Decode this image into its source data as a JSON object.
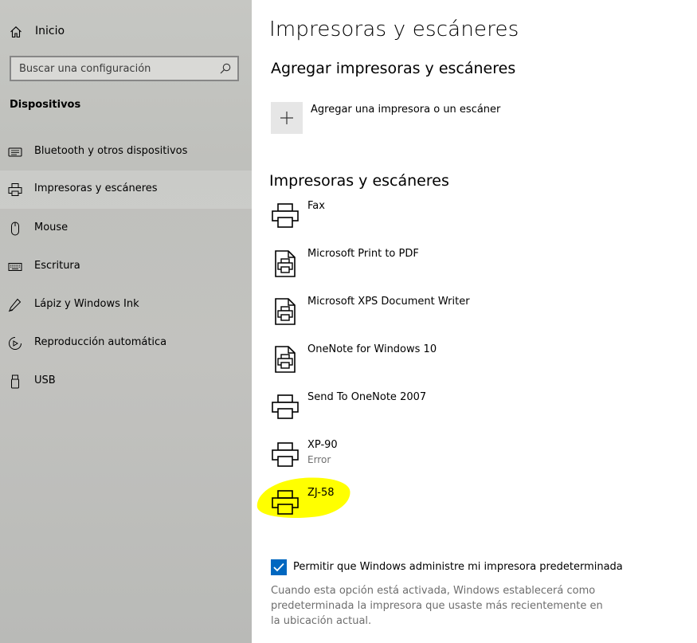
{
  "sidebar": {
    "home_label": "Inicio",
    "search": {
      "placeholder": "Buscar una configuración",
      "value": ""
    },
    "section_title": "Dispositivos",
    "items": [
      {
        "label": "Bluetooth y otros dispositivos",
        "icon": "bluetooth-devices-icon",
        "selected": false
      },
      {
        "label": "Impresoras y escáneres",
        "icon": "printer-icon",
        "selected": true
      },
      {
        "label": "Mouse",
        "icon": "mouse-icon",
        "selected": false
      },
      {
        "label": "Escritura",
        "icon": "keyboard-icon",
        "selected": false
      },
      {
        "label": "Lápiz y Windows Ink",
        "icon": "pen-icon",
        "selected": false
      },
      {
        "label": "Reproducción automática",
        "icon": "autoplay-icon",
        "selected": false
      },
      {
        "label": "USB",
        "icon": "usb-icon",
        "selected": false
      }
    ]
  },
  "main": {
    "title": "Impresoras y escáneres",
    "add_section_title": "Agregar impresoras y escáneres",
    "add_button_label": "Agregar una impresora o un escáner",
    "list_title": "Impresoras y escáneres",
    "printers": [
      {
        "name": "Fax",
        "status": "",
        "icon": "printer-icon"
      },
      {
        "name": "Microsoft Print to PDF",
        "status": "",
        "icon": "document-printer-icon"
      },
      {
        "name": "Microsoft XPS Document Writer",
        "status": "",
        "icon": "document-printer-icon"
      },
      {
        "name": "OneNote for Windows 10",
        "status": "",
        "icon": "document-printer-icon"
      },
      {
        "name": "Send To OneNote 2007",
        "status": "",
        "icon": "printer-icon"
      },
      {
        "name": "XP-90",
        "status": "Error",
        "icon": "printer-icon"
      },
      {
        "name": "ZJ-58",
        "status": "",
        "icon": "printer-icon",
        "highlighted": true
      }
    ],
    "default_checkbox": {
      "label": "Permitir que Windows administre mi impresora predeterminada",
      "checked": true
    },
    "description": "Cuando esta opción está activada, Windows establecerá como predeterminada la impresora que usaste más recientemente en la ubicación actual."
  },
  "colors": {
    "accent": "#0067c0",
    "highlight": "#ffff00",
    "sidebar_bg": "#c2c2bf"
  }
}
